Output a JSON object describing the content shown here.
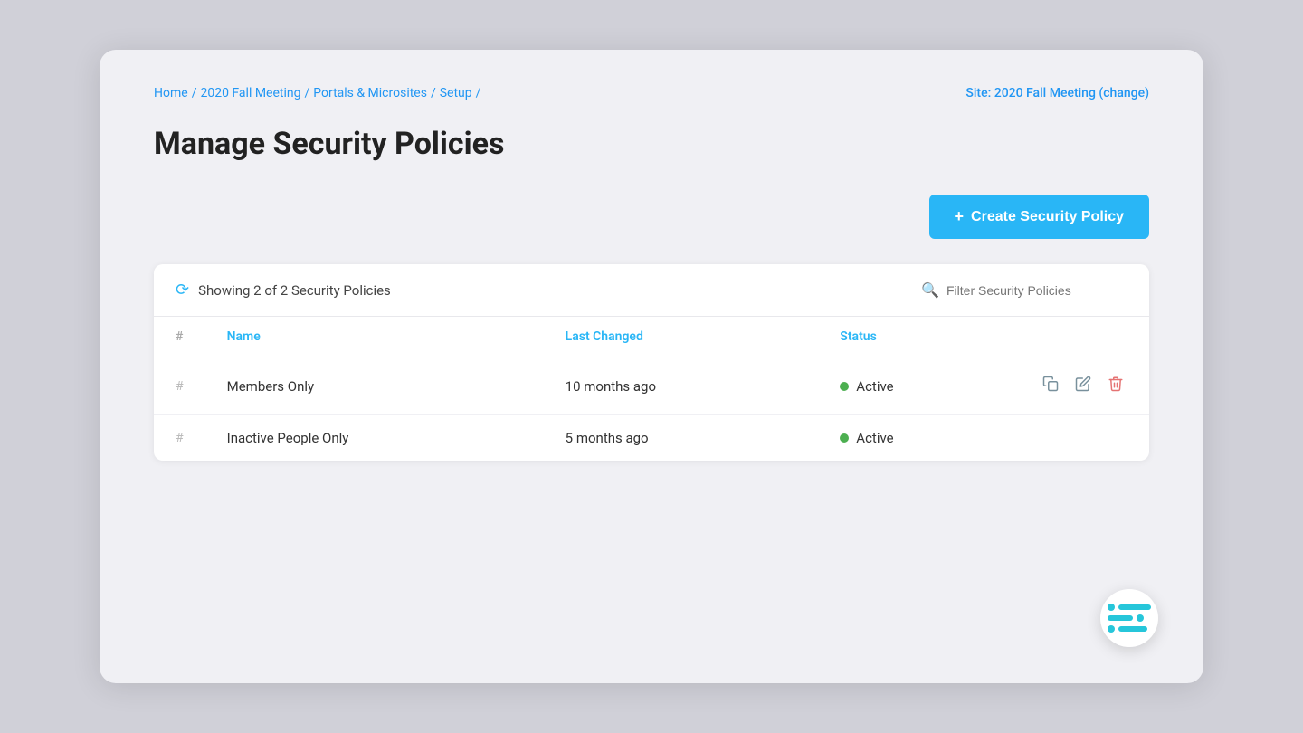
{
  "breadcrumb": {
    "items": [
      "Home",
      "2020 Fall Meeting",
      "Portals & Microsites",
      "Setup"
    ],
    "separators": [
      "/",
      "/",
      "/",
      "/"
    ]
  },
  "site": {
    "label": "Site:",
    "name": "2020 Fall Meeting",
    "action": "(change)"
  },
  "page": {
    "title": "Manage Security Policies"
  },
  "createButton": {
    "label": "Create Security Policy",
    "plus": "+"
  },
  "table": {
    "showingText": "Showing 2 of 2 Security Policies",
    "filterPlaceholder": "Filter Security Policies",
    "columns": {
      "hash": "#",
      "name": "Name",
      "lastChanged": "Last Changed",
      "status": "Status"
    },
    "rows": [
      {
        "hash": "#",
        "name": "Members Only",
        "lastChanged": "10 months ago",
        "status": "Active",
        "statusColor": "#4CAF50",
        "hasActions": true
      },
      {
        "hash": "#",
        "name": "Inactive People Only",
        "lastChanged": "5 months ago",
        "status": "Active",
        "statusColor": "#4CAF50",
        "hasActions": false
      }
    ]
  },
  "actions": {
    "copy": "⧉",
    "edit": "✎",
    "delete": "🗑"
  },
  "colors": {
    "accent": "#29b6f6",
    "activeGreen": "#4CAF50",
    "deleteRed": "#e57373"
  }
}
